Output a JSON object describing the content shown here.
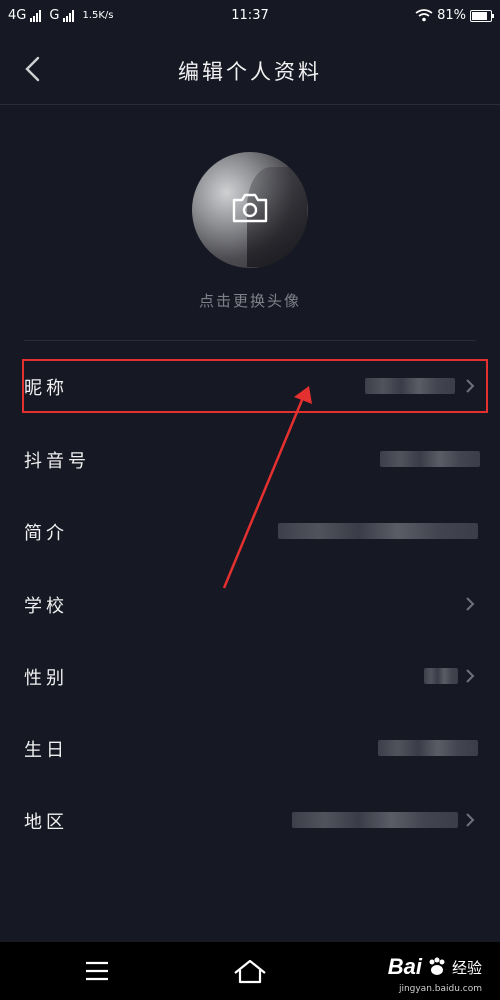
{
  "status_bar": {
    "network_1": "4G",
    "network_2": "G",
    "speed": "1.5K/s",
    "time": "11:37",
    "battery": "81%",
    "battery_level": 0.81
  },
  "nav": {
    "title": "编辑个人资料"
  },
  "avatar": {
    "change_label": "点击更换头像"
  },
  "rows": [
    {
      "label": "昵称"
    },
    {
      "label": "抖音号"
    },
    {
      "label": "简介"
    },
    {
      "label": "学校"
    },
    {
      "label": "性别"
    },
    {
      "label": "生日"
    },
    {
      "label": "地区"
    }
  ],
  "watermark": {
    "brand": "Bai",
    "sub": "经验",
    "url": "jingyan.baidu.com"
  },
  "colors": {
    "background": "#161823",
    "annotation": "#e53030",
    "muted_text": "#7f818a"
  }
}
